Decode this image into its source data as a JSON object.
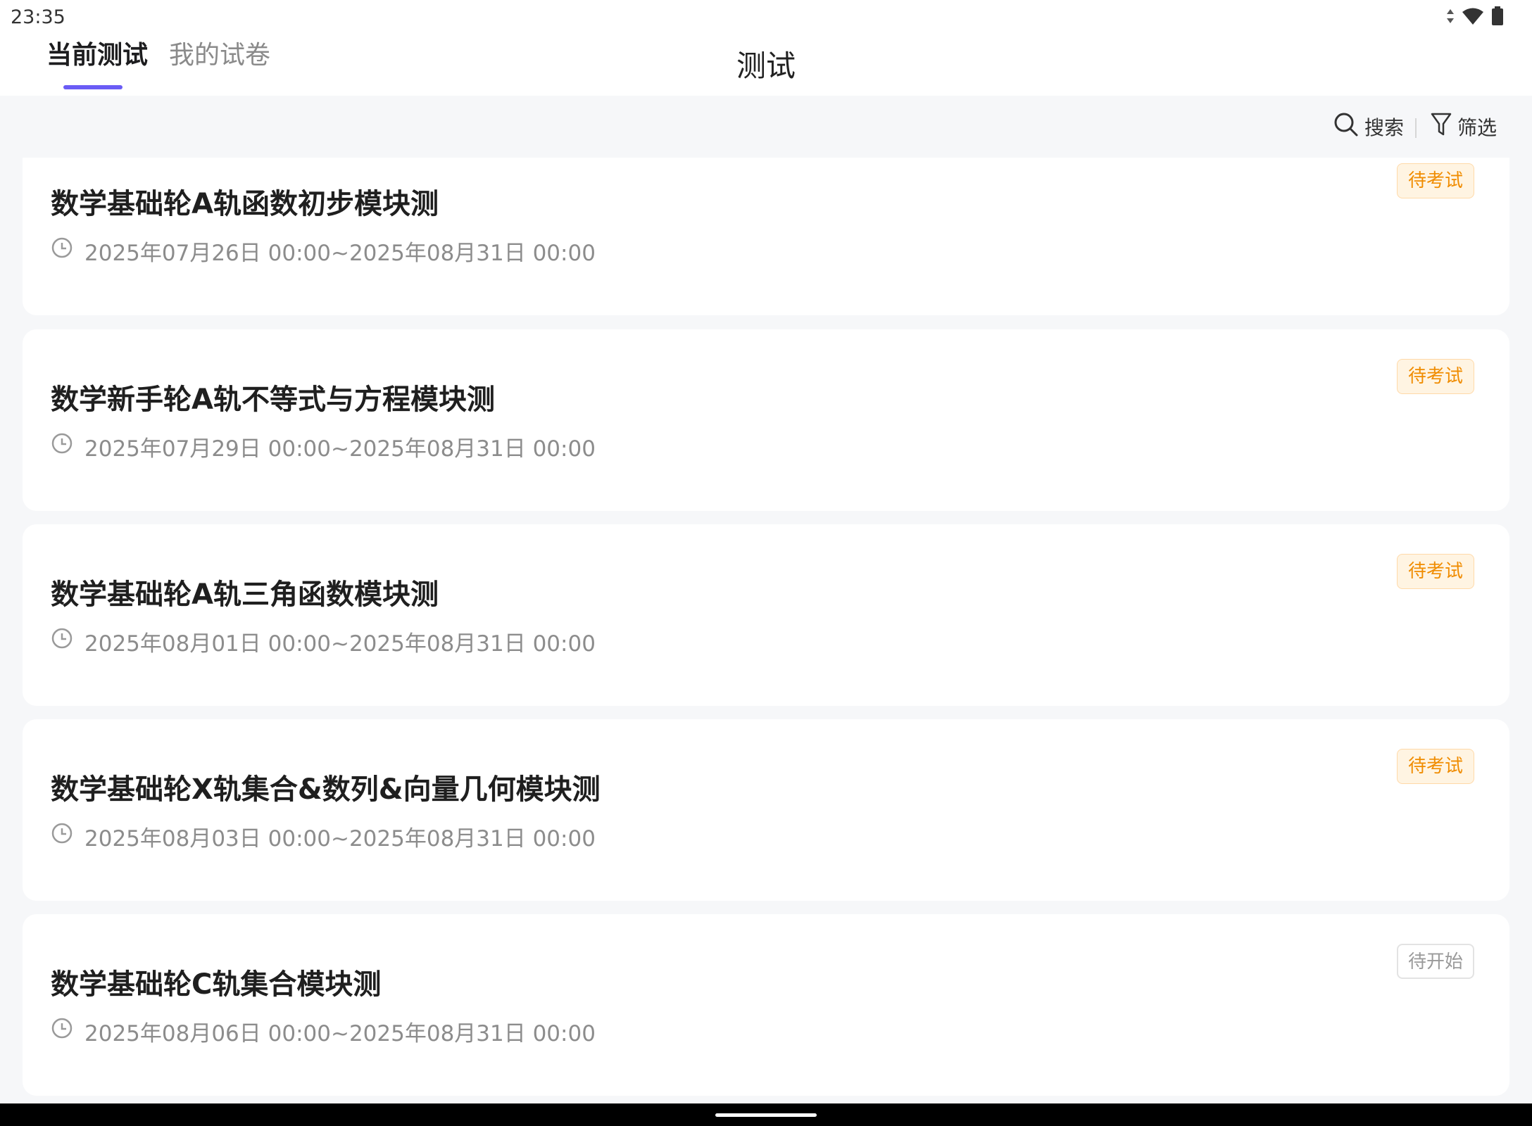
{
  "status_bar": {
    "time": "23:35",
    "icons": [
      "data-arrows-icon",
      "wifi-icon",
      "battery-icon"
    ]
  },
  "tabs": [
    {
      "label": "当前测试",
      "active": true
    },
    {
      "label": "我的试卷",
      "active": false
    }
  ],
  "page_title": "测试",
  "toolbar": {
    "search_label": "搜索",
    "filter_label": "筛选"
  },
  "exams": [
    {
      "title": "数学基础轮A轨函数初步模块测",
      "time": "2025年07月26日 00:00~2025年08月31日 00:00",
      "status": "待考试"
    },
    {
      "title": "数学新手轮A轨不等式与方程模块测",
      "time": "2025年07月29日 00:00~2025年08月31日 00:00",
      "status": "待考试"
    },
    {
      "title": "数学基础轮A轨三角函数模块测",
      "time": "2025年08月01日 00:00~2025年08月31日 00:00",
      "status": "待考试"
    },
    {
      "title": "数学基础轮X轨集合&数列&向量几何模块测",
      "time": "2025年08月03日 00:00~2025年08月31日 00:00",
      "status": "待考试"
    },
    {
      "title": "数学基础轮C轨集合模块测",
      "time": "2025年08月06日 00:00~2025年08月31日 00:00",
      "status": "待开始"
    }
  ],
  "colors": {
    "accent": "#6a5cf5",
    "pending_text": "#f08c00",
    "pending_bg": "#fff4e2",
    "not_started_text": "#9a9a9a"
  }
}
